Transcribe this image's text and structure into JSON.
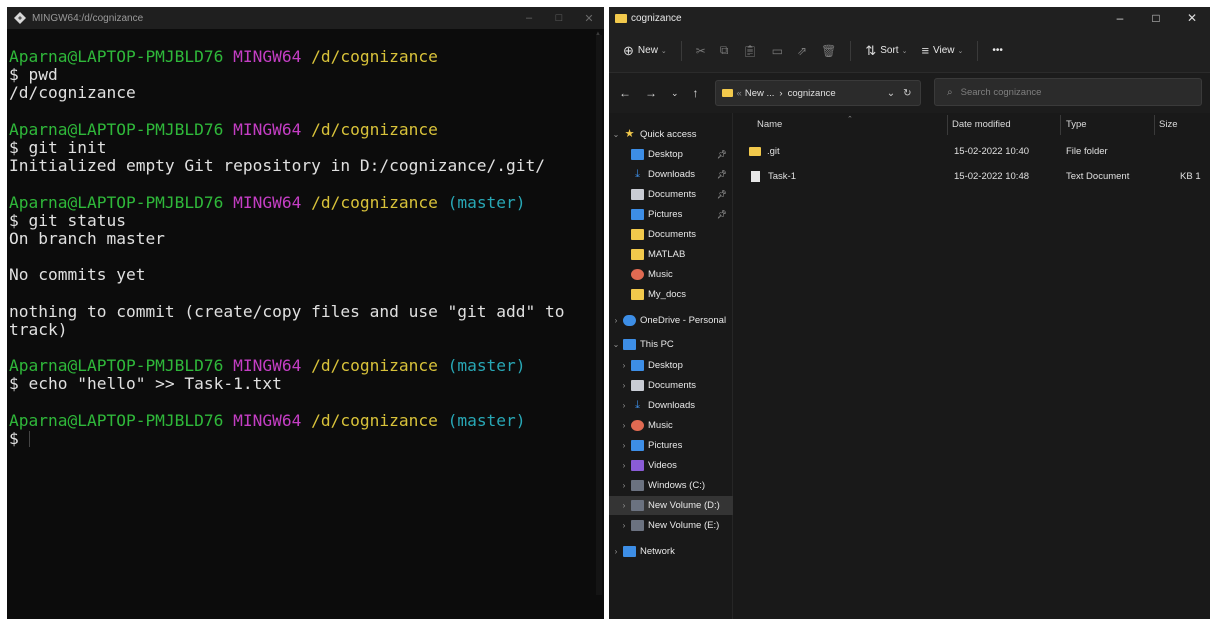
{
  "terminal": {
    "title": "MINGW64:/d/cognizance",
    "controls": [
      "–",
      "□",
      "✕"
    ],
    "lines": [
      [
        {
          "t": "Aparna@LAPTOP-PMJBLD76 ",
          "c": "green"
        },
        {
          "t": "MINGW64 ",
          "c": "magenta"
        },
        {
          "t": "/d/cognizance",
          "c": "yellow"
        }
      ],
      [
        {
          "t": "$ pwd",
          "c": "white"
        }
      ],
      [
        {
          "t": "/d/cognizance",
          "c": "white"
        }
      ],
      [
        {
          "t": "",
          "c": "white"
        }
      ],
      [
        {
          "t": "Aparna@LAPTOP-PMJBLD76 ",
          "c": "green"
        },
        {
          "t": "MINGW64 ",
          "c": "magenta"
        },
        {
          "t": "/d/cognizance",
          "c": "yellow"
        }
      ],
      [
        {
          "t": "$ git init",
          "c": "white"
        }
      ],
      [
        {
          "t": "Initialized empty Git repository in D:/cognizance/.git/",
          "c": "white"
        }
      ],
      [
        {
          "t": "",
          "c": "white"
        }
      ],
      [
        {
          "t": "Aparna@LAPTOP-PMJBLD76 ",
          "c": "green"
        },
        {
          "t": "MINGW64 ",
          "c": "magenta"
        },
        {
          "t": "/d/cognizance ",
          "c": "yellow"
        },
        {
          "t": "(master)",
          "c": "cyan"
        }
      ],
      [
        {
          "t": "$ git status",
          "c": "white"
        }
      ],
      [
        {
          "t": "On branch master",
          "c": "white"
        }
      ],
      [
        {
          "t": "",
          "c": "white"
        }
      ],
      [
        {
          "t": "No commits yet",
          "c": "white"
        }
      ],
      [
        {
          "t": "",
          "c": "white"
        }
      ],
      [
        {
          "t": "nothing to commit (create/copy files and use \"git add\" to",
          "c": "white"
        }
      ],
      [
        {
          "t": "track)",
          "c": "white"
        }
      ],
      [
        {
          "t": "",
          "c": "white"
        }
      ],
      [
        {
          "t": "Aparna@LAPTOP-PMJBLD76 ",
          "c": "green"
        },
        {
          "t": "MINGW64 ",
          "c": "magenta"
        },
        {
          "t": "/d/cognizance ",
          "c": "yellow"
        },
        {
          "t": "(master)",
          "c": "cyan"
        }
      ],
      [
        {
          "t": "$ echo \"hello\" >> Task-1.txt",
          "c": "white"
        }
      ],
      [
        {
          "t": "",
          "c": "white"
        }
      ],
      [
        {
          "t": "Aparna@LAPTOP-PMJBLD76 ",
          "c": "green"
        },
        {
          "t": "MINGW64 ",
          "c": "magenta"
        },
        {
          "t": "/d/cognizance ",
          "c": "yellow"
        },
        {
          "t": "(master)",
          "c": "cyan"
        }
      ],
      [
        {
          "t": "$",
          "c": "white",
          "cursor": true
        }
      ]
    ]
  },
  "explorer": {
    "title": "cognizance",
    "controls": [
      "–",
      "□",
      "✕"
    ],
    "toolbar": {
      "new_label": "New",
      "sort_label": "Sort",
      "view_label": "View",
      "more_label": "•••"
    },
    "address": {
      "overflow": "«",
      "parent": "New ...",
      "separator": "›",
      "current": "cognizance"
    },
    "search_placeholder": "Search cognizance",
    "nav": [
      {
        "label": "Quick access",
        "icon": "star-icon",
        "expander": "⌄",
        "indent": 0
      },
      {
        "label": "Desktop",
        "icon": "desktop-icon",
        "pin": true,
        "indent": 1
      },
      {
        "label": "Downloads",
        "icon": "downloads-icon",
        "pin": true,
        "indent": 1
      },
      {
        "label": "Documents",
        "icon": "documents-icon",
        "pin": true,
        "indent": 1
      },
      {
        "label": "Pictures",
        "icon": "pictures-icon",
        "pin": true,
        "indent": 1
      },
      {
        "label": "Documents",
        "icon": "folder-icon",
        "indent": 1
      },
      {
        "label": "MATLAB",
        "icon": "folder-icon",
        "indent": 1
      },
      {
        "label": "Music",
        "icon": "music-icon",
        "indent": 1
      },
      {
        "label": "My_docs",
        "icon": "folder-icon",
        "indent": 1
      },
      {
        "label": "OneDrive - Personal",
        "icon": "cloud-icon",
        "expander": "›",
        "indent": 0
      },
      {
        "label": "This PC",
        "icon": "pc-icon",
        "expander": "⌄",
        "indent": 0
      },
      {
        "label": "Desktop",
        "icon": "desktop-icon",
        "expander": "›",
        "indent": 1
      },
      {
        "label": "Documents",
        "icon": "documents-icon",
        "expander": "›",
        "indent": 1
      },
      {
        "label": "Downloads",
        "icon": "downloads-icon",
        "expander": "›",
        "indent": 1
      },
      {
        "label": "Music",
        "icon": "music-icon",
        "expander": "›",
        "indent": 1
      },
      {
        "label": "Pictures",
        "icon": "pictures-icon",
        "expander": "›",
        "indent": 1
      },
      {
        "label": "Videos",
        "icon": "videos-icon",
        "expander": "›",
        "indent": 1
      },
      {
        "label": "Windows (C:)",
        "icon": "drive-icon",
        "expander": "›",
        "indent": 1
      },
      {
        "label": "New Volume (D:)",
        "icon": "drive-icon",
        "expander": "›",
        "indent": 1,
        "selected": true
      },
      {
        "label": "New Volume (E:)",
        "icon": "drive-icon",
        "expander": "›",
        "indent": 1
      },
      {
        "label": "Network",
        "icon": "network-icon",
        "expander": "›",
        "indent": 0
      }
    ],
    "columns": [
      "Name",
      "Date modified",
      "Type",
      "Size"
    ],
    "files": [
      {
        "name": ".git",
        "icon": "folder-icon",
        "date": "15-02-2022 10:40",
        "type": "File folder",
        "size": ""
      },
      {
        "name": "Task-1",
        "icon": "text-document-icon",
        "date": "15-02-2022 10:48",
        "type": "Text Document",
        "size": "1 KB"
      }
    ]
  },
  "colors": {
    "terminal_bg": "#0c0c0c",
    "prompt_user": "#2fb83a",
    "prompt_mingw": "#c43ec4",
    "prompt_path": "#d8c23a",
    "prompt_branch": "#28a7b5",
    "explorer_bg": "#191919",
    "folder": "#f2c94c"
  }
}
